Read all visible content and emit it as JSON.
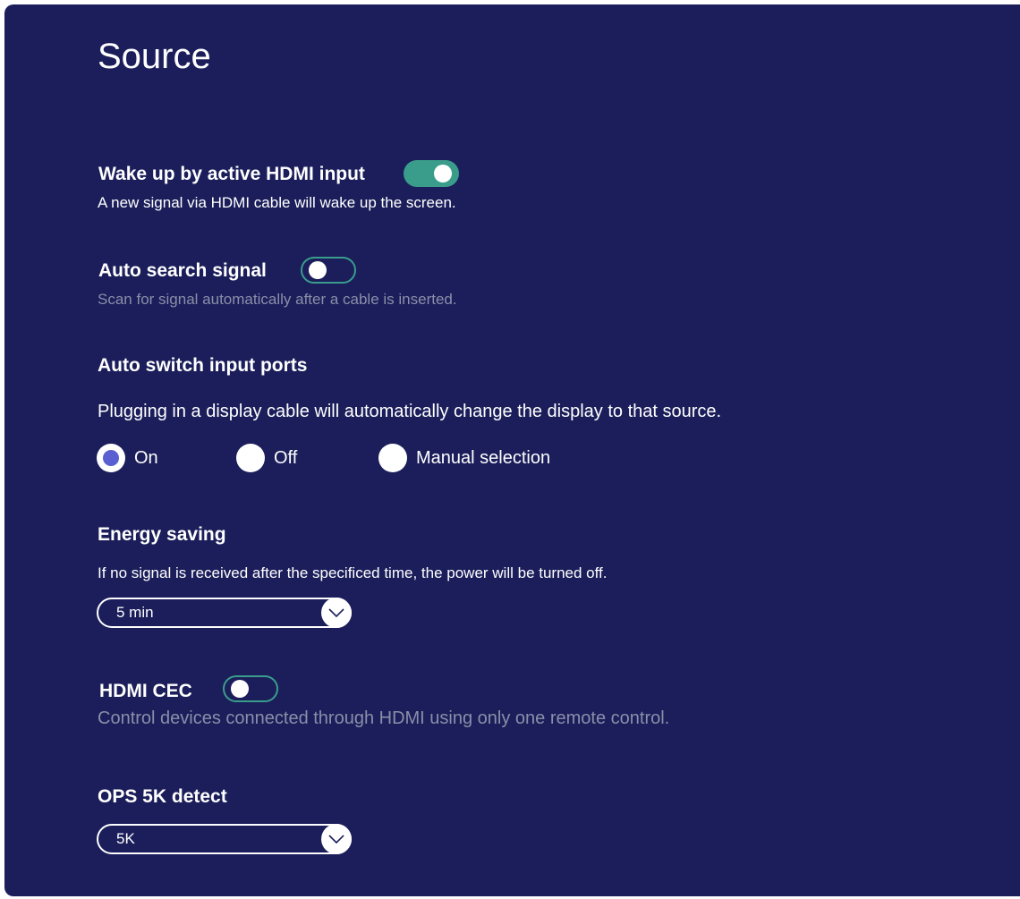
{
  "page": {
    "title": "Source"
  },
  "wake_hdmi": {
    "title": "Wake up by active HDMI input",
    "description": "A new signal via HDMI cable will wake up the screen.",
    "enabled": true
  },
  "auto_search": {
    "title": "Auto search signal",
    "description": "Scan for signal automatically after a cable is inserted.",
    "enabled": false
  },
  "auto_switch": {
    "title": "Auto switch input ports",
    "description": "Plugging in a display cable will automatically change the display to that source.",
    "options": [
      "On",
      "Off",
      "Manual selection"
    ],
    "selected": "On"
  },
  "energy_saving": {
    "title": "Energy saving",
    "description": "If no signal is received after the specificed time, the power will be turned off.",
    "value": "5 min"
  },
  "hdmi_cec": {
    "title": "HDMI CEC",
    "description": "Control devices connected through HDMI using only one remote control.",
    "enabled": false
  },
  "ops_5k": {
    "title": "OPS 5K detect",
    "value": "5K"
  },
  "colors": {
    "background": "#1b1e5a",
    "toggle_on": "#3a9d8c",
    "radio_selected": "#5a5fd1",
    "dim_text": "#8b8ea8"
  },
  "icons": {
    "dropdown": "chevron-down-icon"
  }
}
